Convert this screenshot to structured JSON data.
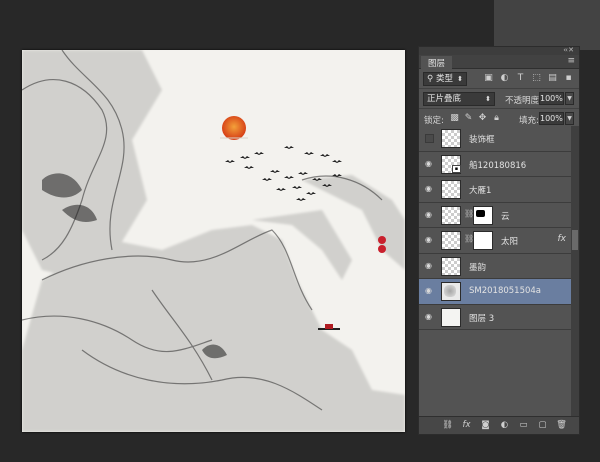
{
  "panel": {
    "tab_label": "图层",
    "menu_icon": "panel-menu-icon",
    "collapse_icon": "double-arrow-icon"
  },
  "filter": {
    "kind_label": "类型",
    "icons": [
      "image-filter-icon",
      "adjustment-filter-icon",
      "type-filter-icon",
      "shape-filter-icon",
      "smart-object-filter-icon"
    ]
  },
  "blend": {
    "mode": "正片叠底",
    "opacity_label": "不透明度:",
    "opacity_value": "100%"
  },
  "lock": {
    "label": "锁定:",
    "fill_label": "填充:",
    "fill_value": "100%"
  },
  "layers": [
    {
      "name": "装饰框",
      "visible": false,
      "thumb": "checker"
    },
    {
      "name": "船120180816",
      "visible": true,
      "thumb": "checker",
      "smart": true
    },
    {
      "name": "大雁1",
      "visible": true,
      "thumb": "checker"
    },
    {
      "name": "云",
      "visible": true,
      "thumb": "checker",
      "mask": "cloud"
    },
    {
      "name": "太阳",
      "visible": true,
      "thumb": "checker",
      "mask": "white",
      "fx": "fx"
    },
    {
      "name": "墨韵",
      "visible": true,
      "thumb": "checker"
    },
    {
      "name": "SM2018051504a",
      "visible": true,
      "thumb": "ink",
      "selected": true
    },
    {
      "name": "图层 3",
      "visible": true,
      "thumb": "plain"
    }
  ],
  "bottom_icons": [
    "link-layers-icon",
    "fx-icon",
    "add-mask-icon",
    "adjustment-layer-icon",
    "new-group-icon",
    "new-layer-icon",
    "trash-icon"
  ],
  "colors": {
    "selected_row": "#6a7ea0",
    "sun": "#e0521f",
    "seal": "#c9202d"
  }
}
